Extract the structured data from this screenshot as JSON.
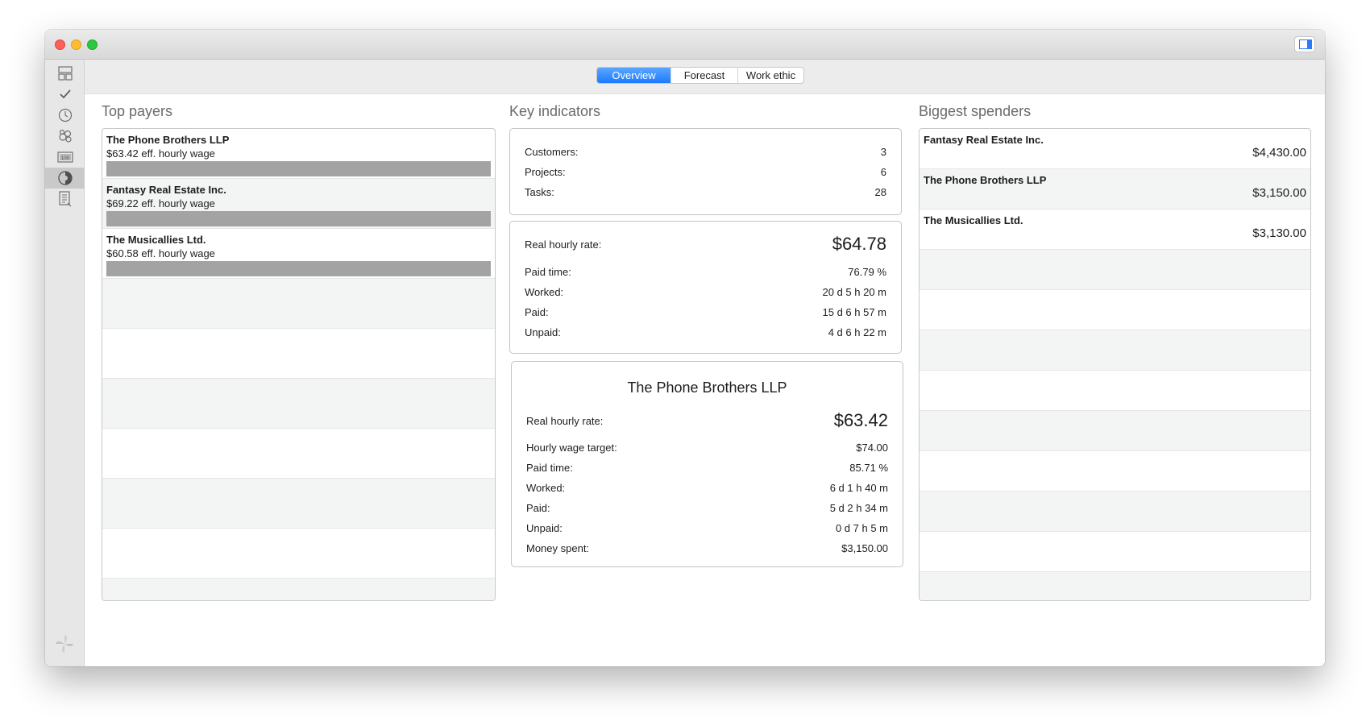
{
  "toolbar": {
    "tabs": [
      {
        "label": "Overview",
        "active": true
      },
      {
        "label": "Forecast",
        "active": false
      },
      {
        "label": "Work ethic",
        "active": false
      }
    ]
  },
  "sidebar": {
    "items": [
      {
        "icon": "dashboard-icon"
      },
      {
        "icon": "checkmark-icon"
      },
      {
        "icon": "clock-icon"
      },
      {
        "icon": "people-icon"
      },
      {
        "icon": "money-icon"
      },
      {
        "icon": "reports-icon",
        "active": true
      },
      {
        "icon": "invoice-icon"
      }
    ],
    "logo_icon": "pinwheel-logo-icon"
  },
  "top_payers": {
    "title": "Top payers",
    "items": [
      {
        "name": "The Phone Brothers LLP",
        "wage": "$63.42 eff. hourly wage"
      },
      {
        "name": "Fantasy Real Estate Inc.",
        "wage": "$69.22 eff. hourly wage"
      },
      {
        "name": "The Musicallies Ltd.",
        "wage": "$60.58 eff. hourly wage"
      }
    ]
  },
  "key_indicators": {
    "title": "Key indicators",
    "counts": [
      {
        "label": "Customers:",
        "value": "3"
      },
      {
        "label": "Projects:",
        "value": "6"
      },
      {
        "label": "Tasks:",
        "value": "28"
      }
    ],
    "overall": {
      "rate_label": "Real hourly rate:",
      "rate_value": "$64.78",
      "rows": [
        {
          "label": "Paid time:",
          "value": "76.79 %"
        },
        {
          "label": "Worked:",
          "value": "20 d 5 h 20 m"
        },
        {
          "label": "Paid:",
          "value": "15 d 6 h 57 m"
        },
        {
          "label": "Unpaid:",
          "value": "4 d 6 h 22 m"
        }
      ]
    },
    "customer": {
      "name": "The Phone Brothers LLP",
      "rate_label": "Real hourly rate:",
      "rate_value": "$63.42",
      "rows": [
        {
          "label": "Hourly wage target:",
          "value": "$74.00"
        },
        {
          "label": "Paid time:",
          "value": "85.71 %"
        },
        {
          "label": "Worked:",
          "value": "6 d 1 h 40 m"
        },
        {
          "label": "Paid:",
          "value": "5 d 2 h 34 m"
        },
        {
          "label": "Unpaid:",
          "value": "0 d 7 h 5 m"
        },
        {
          "label": "Money spent:",
          "value": "$3,150.00"
        }
      ]
    }
  },
  "biggest_spenders": {
    "title": "Biggest spenders",
    "items": [
      {
        "name": "Fantasy Real Estate Inc.",
        "amount": "$4,430.00"
      },
      {
        "name": "The Phone Brothers LLP",
        "amount": "$3,150.00"
      },
      {
        "name": "The Musicallies Ltd.",
        "amount": "$3,130.00"
      }
    ]
  }
}
